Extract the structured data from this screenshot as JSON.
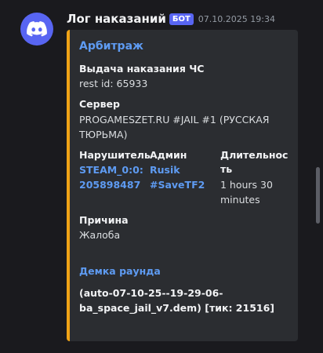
{
  "message": {
    "author": "Лог наказаний",
    "bot_tag": "БОТ",
    "timestamp": "07.10.2025 19:34",
    "avatar_icon": "discord-logo-icon",
    "accent_color": "#f0a316"
  },
  "embed": {
    "title": "Арбитраж",
    "fields": {
      "punishment_name": "Выдача наказания ЧС",
      "punishment_value": "rest id: 65933",
      "server_name": "Сервер",
      "server_value_line1": "PROGAMESZET.RU #JAIL #1 (РУССКАЯ",
      "server_value_line2": "ТЮРЬМА)",
      "offender_name": "Нарушитель",
      "offender_value_line1": "STEAM_0:0:",
      "offender_value_line2": "205898487",
      "admin_name": "Админ",
      "admin_value_line1": "Rusik",
      "admin_value_line2": "#SaveTF2",
      "duration_name_line1": "Длительнос",
      "duration_name_line2": "ть",
      "duration_value_line1": "1 hours 30",
      "duration_value_line2": "minutes",
      "reason_name": "Причина",
      "reason_value": "Жалоба",
      "demo_name": "Демка раунда",
      "demo_value_line1": "(auto-07-10-25--19-29-06-",
      "demo_value_line2": "ba_space_jail_v7.dem) [тик: 21516]"
    }
  }
}
